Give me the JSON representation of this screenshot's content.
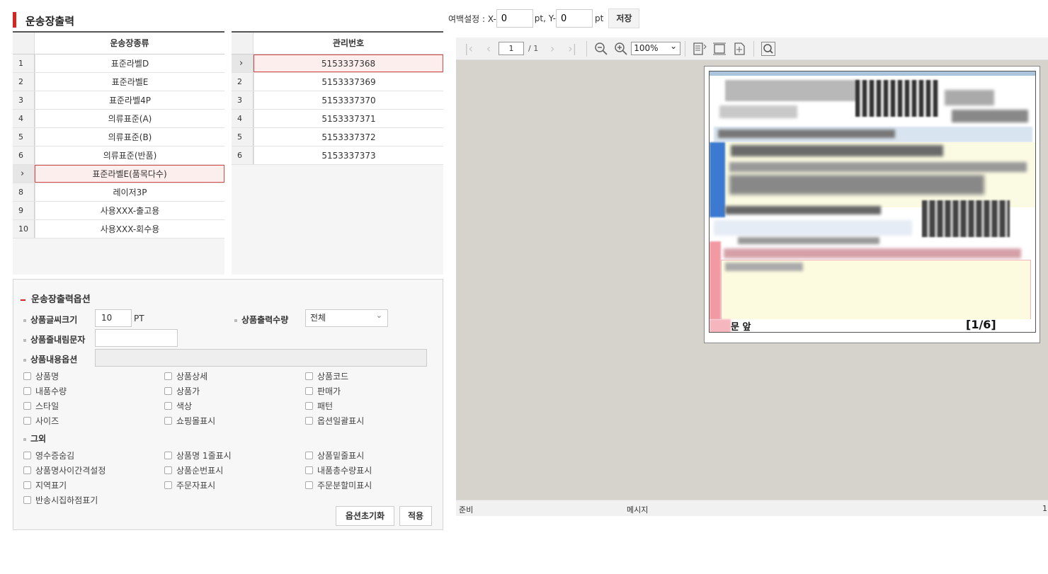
{
  "title": "운송장출력",
  "type_grid": {
    "header": "운송장종류",
    "rows": [
      {
        "no": "1",
        "name": "표준라벨D"
      },
      {
        "no": "2",
        "name": "표준라벨E"
      },
      {
        "no": "3",
        "name": "표준라벨4P"
      },
      {
        "no": "4",
        "name": "의류표준(A)"
      },
      {
        "no": "5",
        "name": "의류표준(B)"
      },
      {
        "no": "6",
        "name": "의류표준(반품)"
      },
      {
        "no": "›",
        "name": "표준라벨E(품목다수)"
      },
      {
        "no": "8",
        "name": "레이저3P"
      },
      {
        "no": "9",
        "name": "사용XXX-출고용"
      },
      {
        "no": "10",
        "name": "사용XXX-회수용"
      }
    ]
  },
  "mgmt_grid": {
    "header": "관리번호",
    "rows": [
      {
        "no": "›",
        "value": "5153337368"
      },
      {
        "no": "2",
        "value": "5153337369"
      },
      {
        "no": "3",
        "value": "5153337370"
      },
      {
        "no": "4",
        "value": "5153337371"
      },
      {
        "no": "5",
        "value": "5153337372"
      },
      {
        "no": "6",
        "value": "5153337373"
      }
    ]
  },
  "margin": {
    "label": "여백설정 : X-",
    "x_value": "0",
    "y_label": "pt, Y-",
    "y_value": "0",
    "unit": "pt",
    "save_label": "저장"
  },
  "viewer": {
    "page_current": "1",
    "page_total": "/ 1",
    "zoom": "100%",
    "status_left": "준비",
    "status_mid": "메시지",
    "status_right": "1",
    "label_footer_left": "문 앞",
    "label_footer_right": "[1/6]"
  },
  "options": {
    "title": "운송장출력옵션",
    "font_size_label": "상품글씨크기",
    "font_size_value": "10",
    "font_size_unit": "PT",
    "print_qty_label": "상품출력수량",
    "print_qty_value": "전체",
    "line_break_label": "상품줄내림문자",
    "line_break_value": "",
    "content_label": "상품내용옵션",
    "content_checks": [
      "상품명",
      "상품상세",
      "상품코드",
      "내품수량",
      "상품가",
      "판매가",
      "스타일",
      "색상",
      "패턴",
      "사이즈",
      "쇼핑몰표시",
      "옵션일괄표시"
    ],
    "etc_label": "그외",
    "etc_checks": [
      "영수증숨김",
      "상품명 1줄표시",
      "상품밑줄표시",
      "상품명사이간격설정",
      "상품순번표시",
      "내품총수량표시",
      "지역표기",
      "주문자표시",
      "주문분할미표시",
      "반송시집하점표기"
    ],
    "reset_label": "옵션초기화",
    "apply_label": "적용"
  }
}
